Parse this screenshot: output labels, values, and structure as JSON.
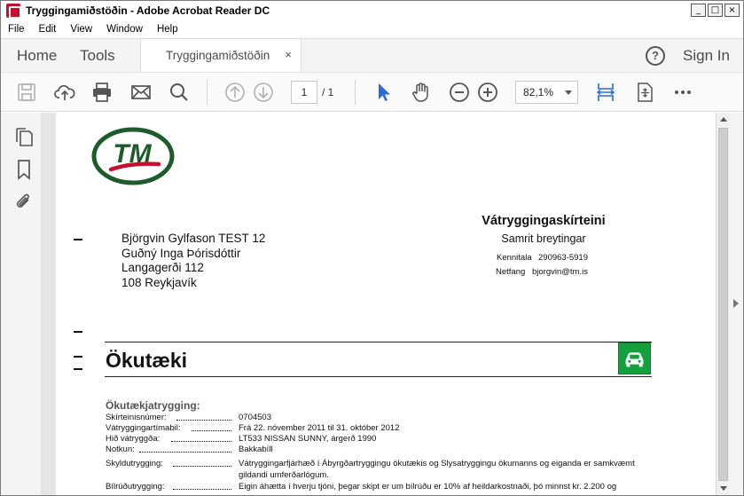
{
  "window": {
    "title": "Tryggingamiðstöðin - Adobe Acrobat Reader DC",
    "controls": [
      "_",
      "□",
      "×"
    ]
  },
  "menu": [
    "File",
    "Edit",
    "View",
    "Window",
    "Help"
  ],
  "tabs": {
    "home": "Home",
    "tools": "Tools",
    "document": "Tryggingamiðstöðin",
    "close": "×",
    "help": "?",
    "sign_in": "Sign In"
  },
  "toolbar": {
    "page_current": "1",
    "page_total": "/  1",
    "zoom": "82,1%"
  },
  "document": {
    "logo_text": "TM",
    "address": [
      "Björgvin Gylfason TEST 12",
      "Guðný Inga Þórisdóttir",
      "Langagerði 112",
      "108 Reykjavík"
    ],
    "certificate": {
      "title": "Vátryggingaskírteini",
      "subtitle": "Samrit breytingar",
      "kennitala_label": "Kennitala",
      "kennitala_value": "290963-5919",
      "netfang_label": "Netfang",
      "netfang_value": "bjorgvin@tm.is"
    },
    "section_title": "Ökutæki",
    "subsection_title": "Ökutækjatrygging:",
    "rows": [
      {
        "label": "Skírteinisnúmer:",
        "value": "0704503"
      },
      {
        "label": "Vátryggingartímabil:",
        "value": "Frá 22. nóvember 2011 til 31. október 2012"
      },
      {
        "label": "Hið vátryggða:",
        "value": "LT533 NISSAN SUNNY, árgerð 1990"
      },
      {
        "label": "Notkun:",
        "value": "Bakkabíll"
      },
      {
        "label": "Skyldutrygging:",
        "value": "Vátryggingarfjárhæð í Ábyrgðartryggingu ökutækis og Slysatryggingu ökumanns og eiganda  er samkvæmt gildandi umferðarlögum."
      },
      {
        "label": "Bílrúðutrygging:",
        "value": "Eigin áhætta í hverju tjóni, þegar skipt er um bílrúðu er 10% af heildarkostnaði, þó minnst kr. 2.200 og"
      }
    ]
  },
  "colors": {
    "logo_green": "#1e5b2a",
    "logo_red": "#c8102e",
    "car_badge": "#14a03c",
    "acrobat_blue": "#2b6ad8"
  }
}
